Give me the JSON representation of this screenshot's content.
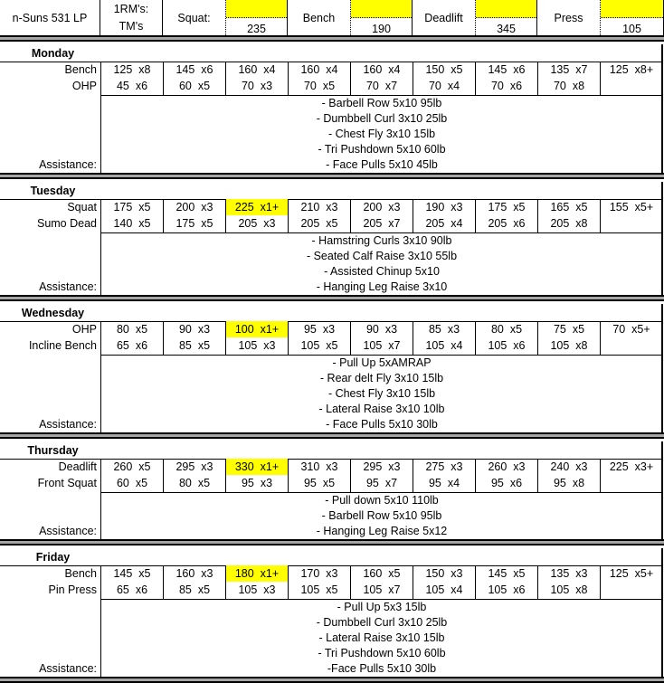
{
  "header": {
    "program_title": "n-Suns 531 LP",
    "rm_label_top": "1RM's:",
    "rm_label_bottom": "TM's",
    "lifts": [
      {
        "label": "Squat:",
        "tm": "235",
        "highlight": "#ffff00"
      },
      {
        "label": "Bench",
        "tm": "190",
        "highlight": "#ffff00"
      },
      {
        "label": "Deadlift",
        "tm": "345",
        "highlight": "#ffff00"
      },
      {
        "label": "Press",
        "tm": "105",
        "highlight": "#ffff00"
      }
    ]
  },
  "assistance_label": "Assistance:",
  "highlight_color": "#ffff00",
  "days": [
    {
      "name": "Monday",
      "primary": {
        "lift": "Bench",
        "sets": [
          "125  x8",
          "145  x6",
          "160  x4",
          "160  x4",
          "160  x4",
          "150  x5",
          "145  x6",
          "135  x7",
          "125  x8+"
        ],
        "highlight_index": -1
      },
      "secondary": {
        "lift": "OHP",
        "sets": [
          "45  x6",
          "60  x5",
          "70  x3",
          "70  x5",
          "70  x7",
          "70  x4",
          "70  x6",
          "70  x8",
          ""
        ]
      },
      "assistance": [
        "- Barbell Row 5x10 95lb",
        "- Dumbbell Curl 3x10 25lb",
        "- Chest Fly 3x10 15lb",
        "- Tri Pushdown 5x10 60lb",
        "- Face Pulls 5x10 45lb"
      ]
    },
    {
      "name": "Tuesday",
      "primary": {
        "lift": "Squat",
        "sets": [
          "175  x5",
          "200  x3",
          "225  x1+",
          "210  x3",
          "200  x3",
          "190  x3",
          "175  x5",
          "165  x5",
          "155  x5+"
        ],
        "highlight_index": 2
      },
      "secondary": {
        "lift": "Sumo Dead",
        "sets": [
          "140  x5",
          "175  x5",
          "205  x3",
          "205  x5",
          "205  x7",
          "205  x4",
          "205  x6",
          "205  x8",
          ""
        ]
      },
      "assistance": [
        "- Hamstring Curls 3x10 90lb",
        "- Seated Calf Raise 3x10 55lb",
        "- Assisted Chinup 5x10",
        "- Hanging Leg Raise 3x10"
      ]
    },
    {
      "name": "Wednesday",
      "primary": {
        "lift": "OHP",
        "sets": [
          "80  x5",
          "90  x3",
          "100  x1+",
          "95  x3",
          "90  x3",
          "85  x3",
          "80  x5",
          "75  x5",
          "70  x5+"
        ],
        "highlight_index": 2
      },
      "secondary": {
        "lift": "Incline Bench",
        "sets": [
          "65  x6",
          "85  x5",
          "105  x3",
          "105  x5",
          "105  x7",
          "105  x4",
          "105  x6",
          "105  x8",
          ""
        ]
      },
      "assistance": [
        "- Pull Up 5xAMRAP",
        "- Rear delt Fly 3x10 15lb",
        "- Chest Fly 3x10 15lb",
        "- Lateral Raise 3x10 10lb",
        "- Face Pulls 5x10 30lb"
      ]
    },
    {
      "name": "Thursday",
      "primary": {
        "lift": "Deadlift",
        "sets": [
          "260  x5",
          "295  x3",
          "330  x1+",
          "310  x3",
          "295  x3",
          "275  x3",
          "260  x3",
          "240  x3",
          "225  x3+"
        ],
        "highlight_index": 2
      },
      "secondary": {
        "lift": "Front Squat",
        "sets": [
          "60  x5",
          "80  x5",
          "95  x3",
          "95  x5",
          "95  x7",
          "95  x4",
          "95  x6",
          "95  x8",
          ""
        ]
      },
      "assistance": [
        "- Pull down 5x10 110lb",
        "- Barbell Row 5x10 95lb",
        "- Hanging Leg Raise 5x12"
      ]
    },
    {
      "name": "Friday",
      "primary": {
        "lift": "Bench",
        "sets": [
          "145  x5",
          "160  x3",
          "180  x1+",
          "170  x3",
          "160  x5",
          "150  x3",
          "145  x5",
          "135  x3",
          "125  x5+"
        ],
        "highlight_index": 2
      },
      "secondary": {
        "lift": "Pin Press",
        "sets": [
          "65  x6",
          "85  x5",
          "105  x3",
          "105  x5",
          "105  x7",
          "105  x4",
          "105  x6",
          "105  x8",
          ""
        ]
      },
      "assistance": [
        "- Pull Up 5x3 15lb",
        "- Dumbbell Curl 3x10 25lb",
        "- Lateral Raise 3x10 15lb",
        "- Tri Pushdown 5x10 60lb",
        "-Face Pulls 5x10 30lb"
      ]
    }
  ]
}
